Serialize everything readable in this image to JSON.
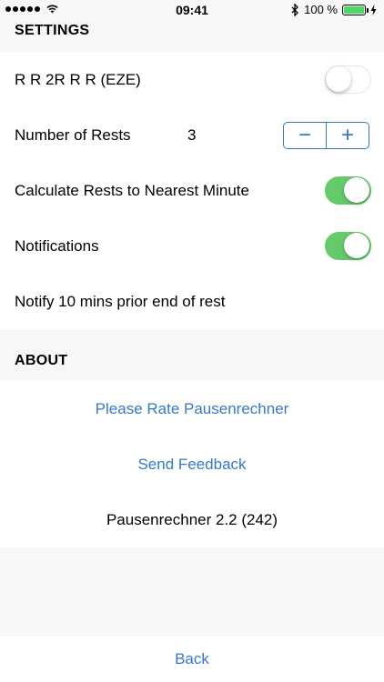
{
  "status_bar": {
    "time": "09:41",
    "battery_text": "100 %",
    "battery_color": "#4cd964",
    "icons": [
      "signal-dots",
      "wifi-icon",
      "bluetooth-icon",
      "battery-icon",
      "charging-icon"
    ]
  },
  "settings": {
    "header": "SETTINGS",
    "eze_label": "R R 2R R R (EZE)",
    "eze_on": false,
    "rests_label": "Number of Rests",
    "rests_value": "3",
    "stepper_minus": "−",
    "stepper_plus": "+",
    "round_label": "Calculate Rests to Nearest Minute",
    "round_on": true,
    "notifications_label": "Notifications",
    "notifications_on": true,
    "notify_label": "Notify 10 mins prior end of rest"
  },
  "about": {
    "header": "ABOUT",
    "rate_label": "Please Rate Pausenrechner",
    "feedback_label": "Send Feedback",
    "version_label": "Pausenrechner 2.2 (242)"
  },
  "footer": {
    "back_label": "Back"
  },
  "colors": {
    "accent": "#3479c8",
    "toggle_on": "#65cb6a",
    "background": "#f7f7f7"
  }
}
